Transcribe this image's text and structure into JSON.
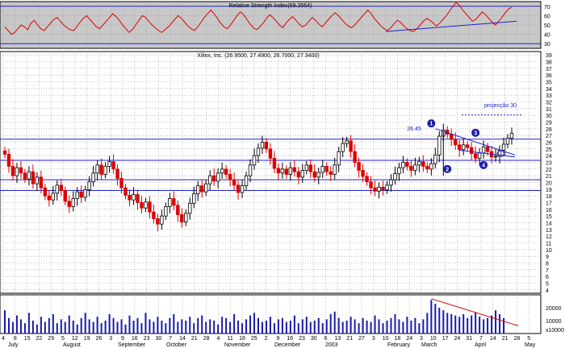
{
  "chart_data": {
    "type": "candlestick",
    "title": "Xilinx, Inc. (26.9500, 27.4900, 26.7000, 27.3400)",
    "rsi_panel": {
      "title": "Relative Strength Index(69.3564)",
      "y_ticks": [
        "70",
        "60",
        "50",
        "40",
        "30"
      ],
      "y_range": [
        25,
        75
      ],
      "overbought": 70,
      "oversold": 30,
      "values": [
        48,
        44,
        40,
        42,
        46,
        50,
        48,
        45,
        52,
        55,
        50,
        46,
        44,
        48,
        52,
        56,
        58,
        54,
        50,
        47,
        45,
        44,
        48,
        53,
        57,
        60,
        56,
        52,
        48,
        46,
        50,
        54,
        58,
        62,
        59,
        55,
        50,
        46,
        42,
        45,
        50,
        55,
        60,
        58,
        54,
        50,
        47,
        44,
        42,
        45,
        48,
        52,
        56,
        60,
        57,
        53,
        49,
        46,
        44,
        48,
        53,
        58,
        62,
        66,
        62,
        57,
        52,
        48,
        46,
        50,
        55,
        60,
        64,
        61,
        56,
        51,
        47,
        45,
        48,
        52,
        57,
        61,
        58,
        54,
        50,
        47,
        52,
        56,
        59,
        55,
        51,
        48,
        50,
        54,
        58,
        55,
        51,
        48,
        52,
        56,
        60,
        63,
        60,
        56,
        52,
        49,
        47,
        50,
        54,
        58,
        62,
        66,
        62,
        57,
        53,
        49,
        46,
        44,
        47,
        51,
        55,
        53,
        49,
        46,
        44,
        43,
        46,
        50,
        54,
        57,
        55,
        52,
        49,
        52,
        56,
        60,
        65,
        70,
        74,
        71,
        66,
        62,
        58,
        54,
        56,
        60,
        64,
        61,
        57,
        53,
        50,
        54,
        58,
        63,
        67,
        69
      ]
    },
    "price_panel": {
      "y_ticks": [
        "39",
        "38",
        "37",
        "36",
        "35",
        "34",
        "33",
        "32",
        "31",
        "30",
        "29",
        "28",
        "27",
        "26",
        "25",
        "24",
        "23",
        "22",
        "21",
        "20",
        "19",
        "18",
        "17",
        "16",
        "15",
        "14",
        "13",
        "12",
        "11",
        "10",
        "9",
        "8",
        "7",
        "6",
        "5",
        "4"
      ],
      "y_range": [
        3.5,
        39.5
      ],
      "last_close": 27.34,
      "closes": [
        24.2,
        22.4,
        21.0,
        22.2,
        21.4,
        20.5,
        21.6,
        19.8,
        20.8,
        19.2,
        18.0,
        17.4,
        18.4,
        19.6,
        18.8,
        17.2,
        16.4,
        17.6,
        18.6,
        17.8,
        18.9,
        20.1,
        21.4,
        22.6,
        21.2,
        22.4,
        23.1,
        22.0,
        20.6,
        19.2,
        18.1,
        17.4,
        18.2,
        17.0,
        16.2,
        17.1,
        15.6,
        14.6,
        13.8,
        15.0,
        16.4,
        17.6,
        16.6,
        15.2,
        14.1,
        15.4,
        16.9,
        18.3,
        19.5,
        18.6,
        19.8,
        21.0,
        20.2,
        21.4,
        22.0,
        21.2,
        20.4,
        19.6,
        18.5,
        19.5,
        21.0,
        22.6,
        24.0,
        25.1,
        26.0,
        25.0,
        23.6,
        22.1,
        21.4,
        22.0,
        21.2,
        22.2,
        21.6,
        20.8,
        21.8,
        22.6,
        21.6,
        20.8,
        21.5,
        22.4,
        21.6,
        21.2,
        22.6,
        24.6,
        25.8,
        26.2,
        24.6,
        23.0,
        21.8,
        20.9,
        20.1,
        19.2,
        18.7,
        19.3,
        18.9,
        19.6,
        20.4,
        21.3,
        22.2,
        23.0,
        22.4,
        21.8,
        22.6,
        23.1,
        22.4,
        22.0,
        22.8,
        24.1,
        26.9,
        27.8,
        27.2,
        26.4,
        25.6,
        24.9,
        25.6,
        25.2,
        24.3,
        23.6,
        24.4,
        25.3,
        24.6,
        23.8,
        23.9,
        24.8,
        25.7,
        26.6,
        27.34
      ],
      "horizontal_lines": [
        26.45,
        23.3,
        20.4,
        18.8
      ],
      "target_line": {
        "label": "projecção 30",
        "value": 30.05
      },
      "level_label": "26.45",
      "markers": [
        "1",
        "2",
        "3",
        "4"
      ]
    },
    "volume_panel": {
      "y_ticks": [
        "20000",
        "10000",
        "x10000"
      ],
      "bars": [
        1.8,
        1.2,
        0.9,
        1.4,
        1.1,
        0.8,
        1.6,
        1.0,
        0.7,
        1.3,
        0.9,
        1.2,
        1.5,
        0.8,
        1.1,
        0.9,
        1.4,
        1.0,
        0.7,
        1.2,
        1.6,
        1.1,
        0.9,
        1.3,
        0.8,
        1.0,
        1.5,
        1.2,
        0.9,
        1.1,
        0.7,
        1.4,
        1.0,
        1.2,
        0.8,
        1.6,
        1.1,
        0.9,
        1.3,
        1.0,
        0.8,
        1.2,
        1.5,
        0.9,
        1.1,
        1.0,
        1.3,
        0.8,
        1.2,
        1.4,
        0.9,
        1.1,
        1.0,
        0.7,
        1.3,
        1.2,
        0.9,
        1.5,
        1.0,
        0.8,
        1.1,
        1.4,
        1.6,
        1.2,
        0.9,
        1.0,
        1.3,
        0.8,
        1.1,
        1.2,
        0.9,
        1.0,
        1.4,
        0.8,
        1.1,
        1.3,
        0.9,
        1.0,
        1.2,
        0.8,
        1.1,
        1.5,
        1.7,
        1.2,
        0.9,
        1.0,
        1.3,
        1.1,
        0.8,
        1.2,
        1.0,
        0.9,
        1.4,
        1.1,
        0.8,
        1.0,
        1.2,
        1.5,
        1.1,
        0.9,
        1.3,
        1.0,
        1.2,
        0.8,
        1.1,
        1.6,
        2.6,
        2.3,
        2.0,
        1.8,
        1.6,
        1.5,
        1.4,
        1.3,
        1.5,
        1.2,
        1.4,
        1.6,
        1.3,
        1.1,
        1.2,
        1.4,
        1.8,
        1.5,
        1.2
      ]
    },
    "x_axis": {
      "day_ticks": [
        "4",
        "8",
        "15",
        "22",
        "29",
        "5",
        "12",
        "19",
        "26",
        "3",
        "9",
        "16",
        "23",
        "30",
        "7",
        "14",
        "21",
        "28",
        "4",
        "11",
        "18",
        "25",
        "2",
        "9",
        "16",
        "23",
        "30",
        "6",
        "13",
        "21",
        "27",
        "3",
        "10",
        "18",
        "24",
        "3",
        "10",
        "17",
        "24",
        "31",
        "7",
        "14",
        "21",
        "28",
        "5"
      ],
      "month_labels": [
        "July",
        "August",
        "September",
        "October",
        "November",
        "December",
        "2003",
        "February",
        "March",
        "April",
        "May"
      ]
    }
  }
}
